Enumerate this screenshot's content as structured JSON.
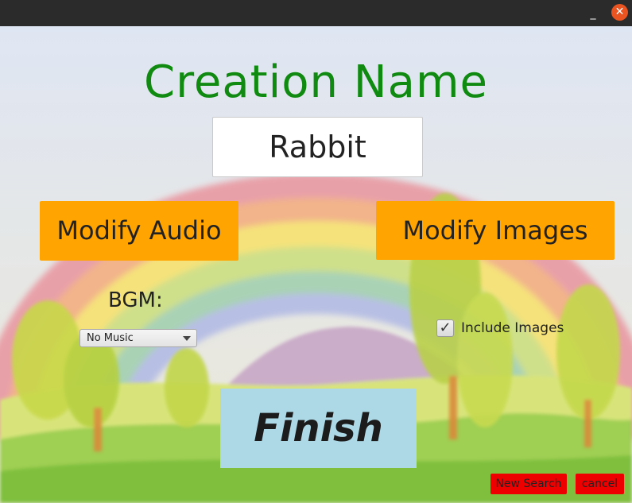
{
  "window": {
    "minimize_glyph": "_",
    "close_glyph": "✕"
  },
  "header": {
    "title": "Creation Name"
  },
  "creation": {
    "name_value": "Rabbit"
  },
  "buttons": {
    "modify_audio": "Modify Audio",
    "modify_images": "Modify Images",
    "finish": "Finish",
    "new_search": "New Search",
    "cancel": "cancel"
  },
  "bgm": {
    "label": "BGM:",
    "selected": "No Music"
  },
  "images_option": {
    "label": "Include Images",
    "checked": true,
    "check_glyph": "✓"
  },
  "colors": {
    "title_green": "#118a11",
    "orange": "#ffa400",
    "finish_blue": "#add8e6",
    "red": "#ee0000",
    "close_orange": "#e95420"
  },
  "icons": [
    "minimize-icon",
    "close-icon",
    "dropdown-arrow-icon",
    "checkmark-icon"
  ]
}
